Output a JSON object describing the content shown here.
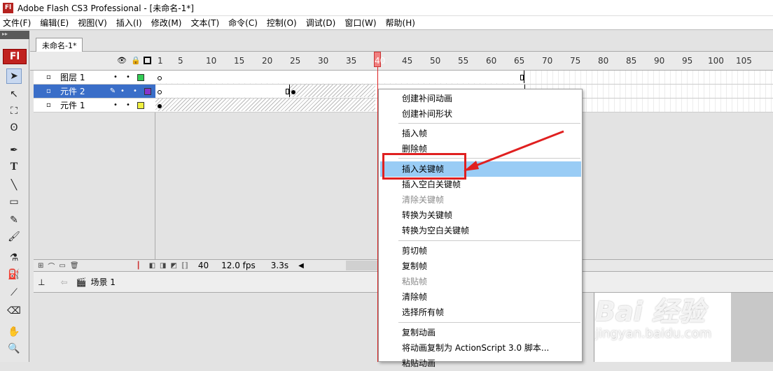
{
  "window": {
    "logo": "Fl",
    "title": "Adobe Flash CS3 Professional - [未命名-1*]"
  },
  "menubar": [
    "文件(F)",
    "编辑(E)",
    "视图(V)",
    "插入(I)",
    "修改(M)",
    "文本(T)",
    "命令(C)",
    "控制(O)",
    "调试(D)",
    "窗口(W)",
    "帮助(H)"
  ],
  "toolbox": {
    "logo": "Fl",
    "tools": [
      "selection-icon",
      "subselection-icon",
      "free-transform-icon",
      "lasso-icon",
      "pen-icon",
      "text-icon",
      "line-icon",
      "rectangle-icon",
      "pencil-icon",
      "brush-icon",
      "ink-bottle-icon",
      "paint-bucket-icon",
      "eyedropper-icon",
      "eraser-icon",
      "hand-icon",
      "zoom-icon"
    ]
  },
  "document_tab": "未命名-1*",
  "ruler": [
    "1",
    "5",
    "10",
    "15",
    "20",
    "25",
    "30",
    "35",
    "40",
    "45",
    "50",
    "55",
    "60",
    "65",
    "70",
    "75",
    "80",
    "85",
    "90",
    "95",
    "100",
    "105"
  ],
  "layers": [
    {
      "name": "图层 1",
      "color": "#33cc55",
      "selected": false
    },
    {
      "name": "元件 2",
      "color": "#8833cc",
      "selected": true
    },
    {
      "name": "元件 1",
      "color": "#f0f040",
      "selected": false
    }
  ],
  "status": {
    "frame": "40",
    "fps": "12.0 fps",
    "time": "3.3s"
  },
  "scene": {
    "label": "场景 1"
  },
  "context_menu": {
    "items": [
      {
        "label": "创建补间动画",
        "disabled": false
      },
      {
        "label": "创建补间形状",
        "disabled": false
      },
      {
        "label": "插入帧",
        "disabled": false
      },
      {
        "label": "删除帧",
        "disabled": false
      },
      {
        "label": "插入关键帧",
        "disabled": false,
        "highlighted": true
      },
      {
        "label": "插入空白关键帧",
        "disabled": false
      },
      {
        "label": "清除关键帧",
        "disabled": true
      },
      {
        "label": "转换为关键帧",
        "disabled": false
      },
      {
        "label": "转换为空白关键帧",
        "disabled": false
      },
      {
        "label": "剪切帧",
        "disabled": false
      },
      {
        "label": "复制帧",
        "disabled": false
      },
      {
        "label": "粘贴帧",
        "disabled": true
      },
      {
        "label": "清除帧",
        "disabled": false
      },
      {
        "label": "选择所有帧",
        "disabled": false
      },
      {
        "label": "复制动画",
        "disabled": false
      },
      {
        "label": "将动画复制为 ActionScript 3.0 脚本...",
        "disabled": false
      },
      {
        "label": "粘贴动画",
        "disabled": false
      }
    ]
  },
  "watermark": {
    "brand": "Bai 经验",
    "url": "jingyan.baidu.com"
  },
  "annotation_color": "#e02020"
}
